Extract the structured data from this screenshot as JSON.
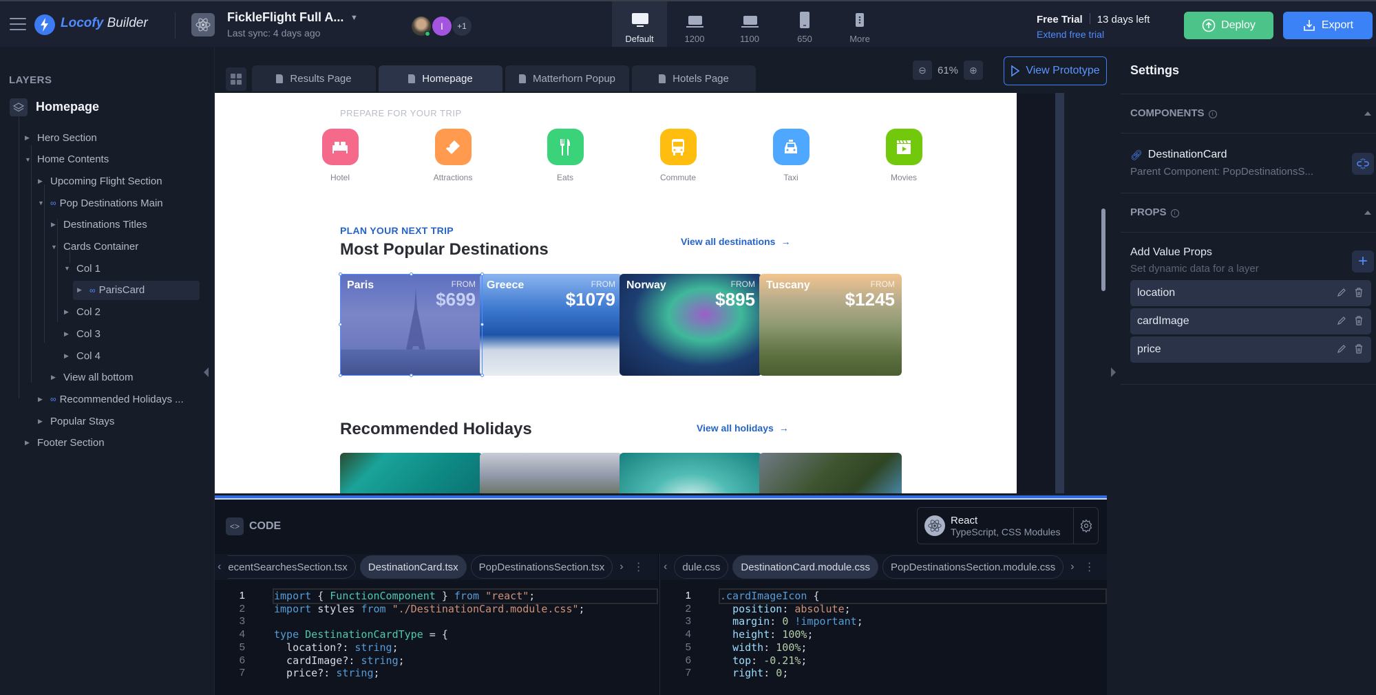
{
  "app": {
    "brand_a": "Locofy",
    "brand_b": "Builder"
  },
  "project": {
    "title": "FickleFlight Full A...",
    "last_sync": "Last sync: 4 days ago"
  },
  "collaborators": {
    "avatar2_initial": "I",
    "extra_count": "+1"
  },
  "devices": [
    {
      "label": "Default",
      "icon": "desktop-icon",
      "active": true
    },
    {
      "label": "1200",
      "icon": "laptop-icon",
      "active": false
    },
    {
      "label": "1100",
      "icon": "laptop-icon",
      "active": false
    },
    {
      "label": "650",
      "icon": "tablet-icon",
      "active": false
    },
    {
      "label": "More",
      "icon": "more-devices-icon",
      "active": false
    }
  ],
  "trial": {
    "label": "Free Trial",
    "days_left": "13 days left",
    "extend": "Extend free trial"
  },
  "actions": {
    "deploy": "Deploy",
    "export": "Export"
  },
  "colors": {
    "accent": "#3b82f6",
    "deploy": "#4cc489",
    "brand": "#3d7bf2"
  },
  "layers": {
    "title": "LAYERS",
    "root": "Homepage",
    "items": [
      {
        "label": "Hero Section",
        "depth": 0,
        "expanded": false,
        "linked": false
      },
      {
        "label": "Home Contents",
        "depth": 0,
        "expanded": true,
        "linked": false
      },
      {
        "label": "Upcoming Flight Section",
        "depth": 1,
        "expanded": false,
        "linked": false
      },
      {
        "label": "Pop Destinations Main",
        "depth": 1,
        "expanded": true,
        "linked": true
      },
      {
        "label": "Destinations Titles",
        "depth": 2,
        "expanded": false,
        "linked": false
      },
      {
        "label": "Cards Container",
        "depth": 2,
        "expanded": true,
        "linked": false
      },
      {
        "label": "Col 1",
        "depth": 3,
        "expanded": true,
        "linked": false
      },
      {
        "label": "ParisCard",
        "depth": 4,
        "expanded": false,
        "linked": true,
        "selected": true
      },
      {
        "label": "Col 2",
        "depth": 3,
        "expanded": false,
        "linked": false
      },
      {
        "label": "Col 3",
        "depth": 3,
        "expanded": false,
        "linked": false
      },
      {
        "label": "Col 4",
        "depth": 3,
        "expanded": false,
        "linked": false
      },
      {
        "label": "View all bottom",
        "depth": 2,
        "expanded": false,
        "linked": false
      },
      {
        "label": "Recommended Holidays ...",
        "depth": 1,
        "expanded": false,
        "linked": true
      },
      {
        "label": "Popular Stays",
        "depth": 1,
        "expanded": false,
        "linked": false
      },
      {
        "label": "Footer Section",
        "depth": 0,
        "expanded": false,
        "linked": false
      }
    ]
  },
  "page_tabs": [
    {
      "label": "Results Page",
      "active": false
    },
    {
      "label": "Homepage",
      "active": true
    },
    {
      "label": "Matterhorn Popup",
      "active": false
    },
    {
      "label": "Hotels Page",
      "active": false
    }
  ],
  "zoom": {
    "level": "61%"
  },
  "view_prototype": "View Prototype",
  "preview": {
    "prepare_label": "PREPARE FOR YOUR TRIP",
    "categories": [
      {
        "label": "Hotel",
        "color": "#f56a8b",
        "icon": "bed-icon"
      },
      {
        "label": "Attractions",
        "color": "#ff9a4f",
        "icon": "ticket-icon"
      },
      {
        "label": "Eats",
        "color": "#3ad37a",
        "icon": "cutlery-icon"
      },
      {
        "label": "Commute",
        "color": "#ffbd10",
        "icon": "bus-icon"
      },
      {
        "label": "Taxi",
        "color": "#4ea8ff",
        "icon": "taxi-icon"
      },
      {
        "label": "Movies",
        "color": "#72c90c",
        "icon": "film-icon"
      }
    ],
    "plan_label": "PLAN YOUR NEXT TRIP",
    "popular_title": "Most Popular Destinations",
    "view_all_destinations": "View all destinations",
    "destinations": [
      {
        "location": "Paris",
        "from": "FROM",
        "price": "$699"
      },
      {
        "location": "Greece",
        "from": "FROM",
        "price": "$1079"
      },
      {
        "location": "Norway",
        "from": "FROM",
        "price": "$895"
      },
      {
        "location": "Tuscany",
        "from": "FROM",
        "price": "$1245"
      }
    ],
    "holidays_title": "Recommended Holidays",
    "view_all_holidays": "View all holidays"
  },
  "code": {
    "title": "CODE",
    "framework": "React",
    "framework_sub": "TypeScript, CSS Modules",
    "left_tabs": [
      "ecentSearchesSection.tsx",
      "DestinationCard.tsx",
      "PopDestinationsSection.tsx"
    ],
    "left_active": 1,
    "right_tabs": [
      "dule.css",
      "DestinationCard.module.css",
      "PopDestinationsSection.module.css"
    ],
    "right_active": 1,
    "tsx_lines": [
      "import { FunctionComponent } from \"react\";",
      "import styles from \"./DestinationCard.module.css\";",
      "",
      "type DestinationCardType = {",
      "  location?: string;",
      "  cardImage?: string;",
      "  price?: string;"
    ],
    "css_lines": [
      ".cardImageIcon {",
      "  position: absolute;",
      "  margin: 0 !important;",
      "  height: 100%;",
      "  width: 100%;",
      "  top: -0.21%;",
      "  right: 0;"
    ]
  },
  "settings": {
    "title": "Settings",
    "components_label": "COMPONENTS",
    "component_name": "DestinationCard",
    "parent_component": "Parent Component: PopDestinationsS...",
    "props_label": "PROPS",
    "add_value_props": "Add Value Props",
    "add_value_props_sub": "Set dynamic data for a layer",
    "props": [
      "location",
      "cardImage",
      "price"
    ]
  }
}
